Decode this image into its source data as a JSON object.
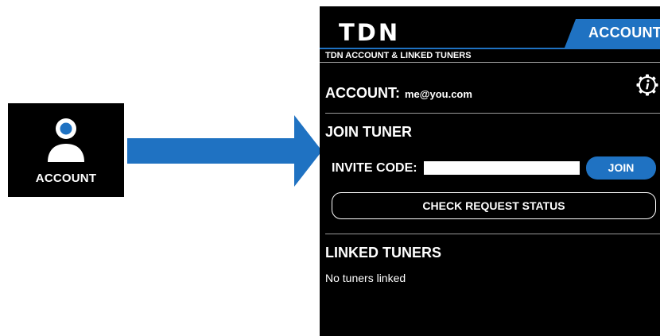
{
  "account_icon_tile": {
    "label": "ACCOUNT",
    "icon": "user-account-icon",
    "accent_color": "#1f72c2"
  },
  "arrow": {
    "icon": "right-arrow",
    "color": "#1f72c2"
  },
  "screen": {
    "logo": "TDN",
    "tab_label": "ACCOUNT",
    "subheader": "TDN ACCOUNT & LINKED TUNERS",
    "account": {
      "label": "ACCOUNT:",
      "email": "me@you.com",
      "info_icon": "info-icon"
    },
    "join_tuner": {
      "title": "JOIN TUNER",
      "invite_label": "INVITE CODE:",
      "invite_value": "",
      "join_button": "JOIN",
      "check_status_button": "CHECK REQUEST STATUS"
    },
    "linked_tuners": {
      "title": "LINKED TUNERS",
      "empty_text": "No tuners linked"
    },
    "accent_color": "#1f72c2"
  }
}
